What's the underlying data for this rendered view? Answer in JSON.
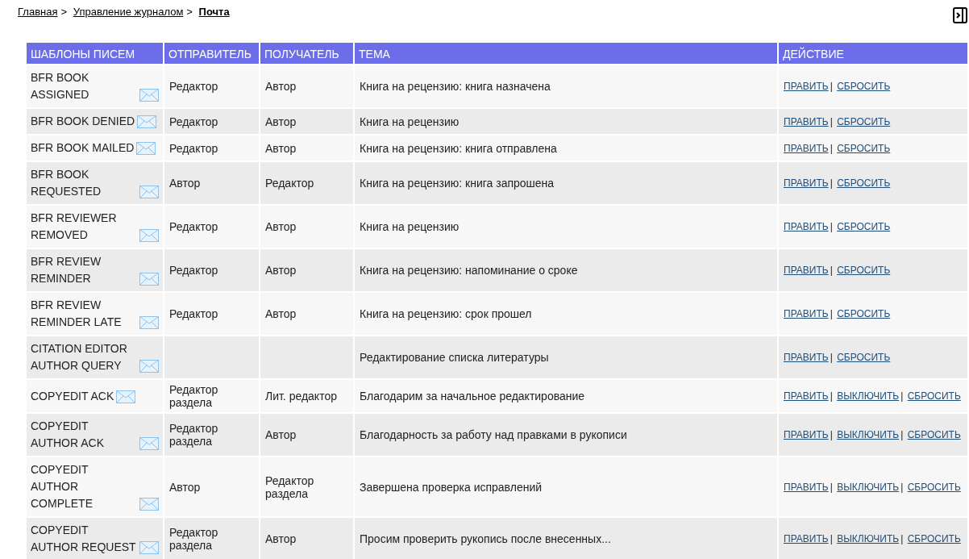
{
  "breadcrumb": [
    {
      "label": "Главная",
      "current": false
    },
    {
      "label": "Управление журналом",
      "current": false
    },
    {
      "label": "Почта",
      "current": true
    }
  ],
  "separator": ">",
  "action_separator": "|",
  "table": {
    "columns": [
      "ШАБЛОНЫ ПИСЕМ",
      "ОТПРАВИТЕЛЬ",
      "ПОЛУЧАТЕЛЬ",
      "ТЕМА",
      "ДЕЙСТВИЕ"
    ],
    "rows": [
      {
        "template": "BFR BOOK ASSIGNED",
        "sender": "Редактор",
        "recipient": "Автор",
        "subject": "Книга на рецензию: книга назначена",
        "actions": [
          "ПРАВИТЬ",
          "СБРОСИТЬ"
        ]
      },
      {
        "template": "BFR BOOK DENIED",
        "sender": "Редактор",
        "recipient": "Автор",
        "subject": "Книга на рецензию",
        "actions": [
          "ПРАВИТЬ",
          "СБРОСИТЬ"
        ]
      },
      {
        "template": "BFR BOOK MAILED",
        "sender": "Редактор",
        "recipient": "Автор",
        "subject": "Книга на рецензию: книга отправлена",
        "actions": [
          "ПРАВИТЬ",
          "СБРОСИТЬ"
        ]
      },
      {
        "template": "BFR BOOK REQUESTED",
        "sender": "Автор",
        "recipient": "Редактор",
        "subject": "Книга на рецензию: книга запрошена",
        "actions": [
          "ПРАВИТЬ",
          "СБРОСИТЬ"
        ]
      },
      {
        "template": "BFR REVIEWER REMOVED",
        "sender": "Редактор",
        "recipient": "Автор",
        "subject": "Книга на рецензию",
        "actions": [
          "ПРАВИТЬ",
          "СБРОСИТЬ"
        ]
      },
      {
        "template": "BFR REVIEW REMINDER",
        "sender": "Редактор",
        "recipient": "Автор",
        "subject": "Книга на рецензию: напоминание о сроке",
        "actions": [
          "ПРАВИТЬ",
          "СБРОСИТЬ"
        ]
      },
      {
        "template": "BFR REVIEW REMINDER LATE",
        "sender": "Редактор",
        "recipient": "Автор",
        "subject": "Книга на рецензию: срок прошел",
        "actions": [
          "ПРАВИТЬ",
          "СБРОСИТЬ"
        ]
      },
      {
        "template": "CITATION EDITOR AUTHOR QUERY",
        "subject": "Редактирование списка литературы",
        "actions": [
          "ПРАВИТЬ",
          "СБРОСИТЬ"
        ]
      },
      {
        "template": "COPYEDIT ACK",
        "sender": "Редактор раздела",
        "recipient": "Лит. редактор",
        "subject": "Благодарим за начальное редактирование",
        "actions": [
          "ПРАВИТЬ",
          "ВЫКЛЮЧИТЬ",
          "СБРОСИТЬ"
        ]
      },
      {
        "template": "COPYEDIT AUTHOR ACK",
        "sender": "Редактор раздела",
        "recipient": "Автор",
        "subject": "Благодарность за работу над правками в рукописи",
        "actions": [
          "ПРАВИТЬ",
          "ВЫКЛЮЧИТЬ",
          "СБРОСИТЬ"
        ]
      },
      {
        "template": "COPYEDIT AUTHOR COMPLETE",
        "sender": "Автор",
        "recipient": "Редактор раздела",
        "subject": "Завершена проверка исправлений",
        "actions": [
          "ПРАВИТЬ",
          "ВЫКЛЮЧИТЬ",
          "СБРОСИТЬ"
        ]
      },
      {
        "template": "COPYEDIT AUTHOR REQUEST",
        "sender": "Редактор раздела",
        "recipient": "Автор",
        "subject": "Просим проверить рукопись после внесенных...",
        "actions": [
          "ПРАВИТЬ",
          "ВЫКЛЮЧИТЬ",
          "СБРОСИТЬ"
        ]
      }
    ]
  }
}
